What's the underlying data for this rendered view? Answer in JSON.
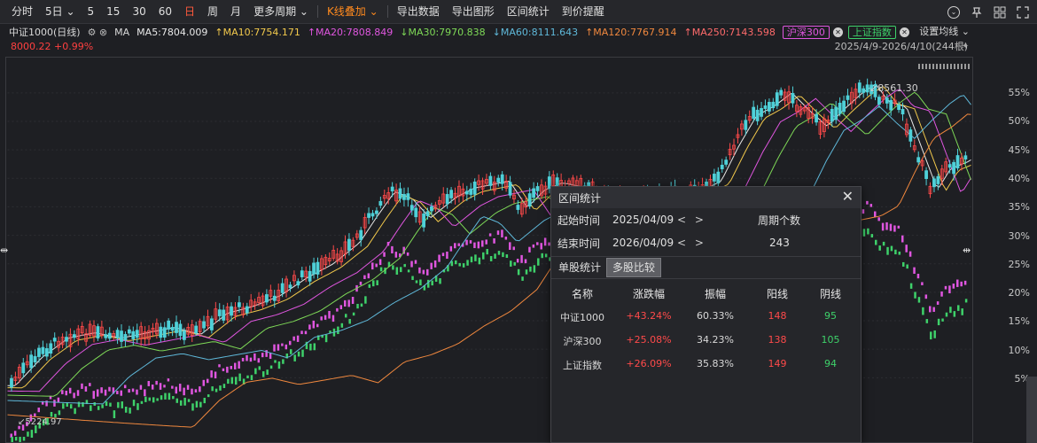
{
  "toolbar": {
    "items": [
      "分时",
      "5日",
      "5",
      "15",
      "30",
      "60",
      "日",
      "周",
      "月",
      "更多周期",
      "K线叠加",
      "导出数据",
      "导出图形",
      "区间统计",
      "到价提醒"
    ],
    "active_index": 6,
    "dropdown_indices": [
      1,
      9,
      10
    ],
    "orange_index": 10,
    "sep_after": [
      9,
      10
    ],
    "icons": [
      "chevron-down-circle-icon",
      "pin-icon",
      "grid-icon",
      "expand-icon"
    ]
  },
  "ma_bar": {
    "name": "中证1000(日线)",
    "ma_label": "MA",
    "ma": [
      {
        "label": "MA5:7804.009",
        "arrow": "",
        "color": "#e8e8e8"
      },
      {
        "label": "MA10:7754.171",
        "arrow": "↑",
        "color": "#f2c94c"
      },
      {
        "label": "MA20:7808.849",
        "arrow": "↑",
        "color": "#e056e0"
      },
      {
        "label": "MA30:7970.838",
        "arrow": "↓",
        "color": "#7ed957"
      },
      {
        "label": "MA60:8111.643",
        "arrow": "↓",
        "color": "#5fb8d9"
      },
      {
        "label": "MA120:7767.914",
        "arrow": "↑",
        "color": "#f0883e"
      },
      {
        "label": "MA250:7143.598",
        "arrow": "↑",
        "color": "#ff6b6b"
      }
    ],
    "tags": [
      {
        "label": "沪深300",
        "color": "#e056e0"
      },
      {
        "label": "上证指数",
        "color": "#3ed16a"
      }
    ],
    "setting": "设置均线"
  },
  "sub_bar": {
    "left": "8000.22 +0.99%",
    "right": "2025/4/9-2026/4/10(244根)"
  },
  "chart_data": {
    "type": "candlestick",
    "title": "中证1000(日线)",
    "range": "2025/4/9-2026/4/10",
    "high_label": "8561.30",
    "low_label": "5224.97",
    "right_axis_ticks": [
      "55%",
      "50%",
      "45%",
      "40%",
      "35%",
      "30%",
      "25%",
      "20%",
      "15%",
      "10%",
      "5%"
    ],
    "series": [
      {
        "name": "中证1000",
        "color": "#ff4a4a"
      },
      {
        "name": "沪深300",
        "color": "#e056e0"
      },
      {
        "name": "上证指数",
        "color": "#3ed16a"
      }
    ]
  },
  "dialog": {
    "title": "区间统计",
    "start_label": "起始时间",
    "start_value": "2025/04/09",
    "end_label": "结束时间",
    "end_value": "2026/04/09",
    "period_label": "周期个数",
    "period_value": "243",
    "tabs": [
      "单股统计",
      "多股比较"
    ],
    "selected_tab": 1,
    "headers": [
      "名称",
      "涨跌幅",
      "振幅",
      "阳线",
      "阴线"
    ],
    "rows": [
      {
        "name": "中证1000",
        "change": "+43.24%",
        "amp": "60.33%",
        "up": "148",
        "down": "95"
      },
      {
        "name": "沪深300",
        "change": "+25.08%",
        "amp": "34.23%",
        "up": "138",
        "down": "105"
      },
      {
        "name": "上证指数",
        "change": "+26.09%",
        "amp": "35.83%",
        "up": "149",
        "down": "94"
      }
    ]
  }
}
